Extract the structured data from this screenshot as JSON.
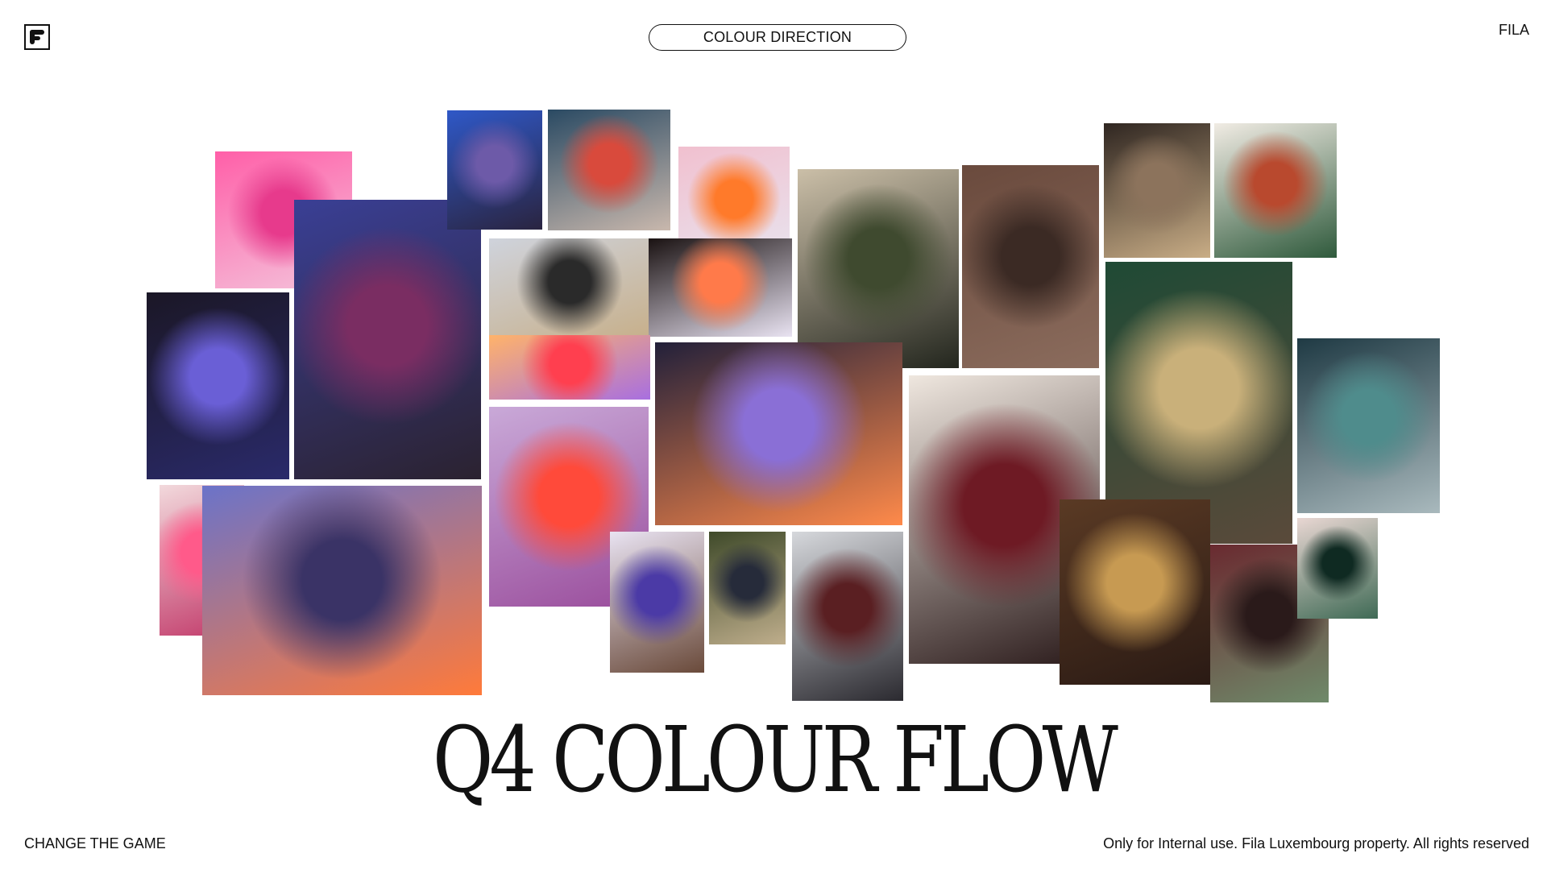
{
  "header": {
    "logo_icon": "fila-f-icon",
    "section_label": "COLOUR DIRECTION",
    "brand": "FILA"
  },
  "title": "Q4 COLOUR FLOW",
  "footer": {
    "tagline": "CHANGE THE GAME",
    "notice": "Only for Internal use. Fila Luxembourg property. All rights reserved"
  },
  "moodboard": {
    "images": [
      {
        "name": "pink-fabric-photo",
        "palette": [
          "#ff5fa8",
          "#e73a8c",
          "#f4c3db"
        ]
      },
      {
        "name": "purple-hooded-runway-photo",
        "palette": [
          "#3a3f95",
          "#7a2d62",
          "#2b2230"
        ]
      },
      {
        "name": "blue-buckle-fur-photo",
        "palette": [
          "#2f58c7",
          "#6d5aa8",
          "#2a2440"
        ]
      },
      {
        "name": "red-glow-dress-photo",
        "palette": [
          "#2a4a63",
          "#d94a3c",
          "#c9b8ad"
        ]
      },
      {
        "name": "orange-boot-ball-photo",
        "palette": [
          "#f1c0cf",
          "#ff7a2a",
          "#e8e4ef"
        ]
      },
      {
        "name": "studio-person-photo",
        "palette": [
          "#cfd3dc",
          "#2a2a2a",
          "#c7b08c"
        ]
      },
      {
        "name": "neon-x-photo",
        "palette": [
          "#1a1212",
          "#ff7a4a",
          "#e9e3f2"
        ]
      },
      {
        "name": "heat-gradient-photo",
        "palette": [
          "#ffb36a",
          "#ff3f4f",
          "#a86fe0"
        ]
      },
      {
        "name": "green-hood-photo",
        "palette": [
          "#cbbfa8",
          "#3f4a2f",
          "#23261e"
        ]
      },
      {
        "name": "brown-collar-photo",
        "palette": [
          "#6a4a3d",
          "#3b2a24",
          "#8b6c5d"
        ]
      },
      {
        "name": "mirror-room-photo",
        "palette": [
          "#2f2621",
          "#8c735c",
          "#c9ad86"
        ]
      },
      {
        "name": "fila-logo-tile-photo",
        "palette": [
          "#f1ece4",
          "#b9492e",
          "#2f5a3c"
        ]
      },
      {
        "name": "purple-puffer-photo",
        "palette": [
          "#1b1726",
          "#6a5fd6",
          "#2a2a6a"
        ]
      },
      {
        "name": "violet-eye-makeup-photo",
        "palette": [
          "#c9a9d8",
          "#ff4a3a",
          "#9a4d9c"
        ]
      },
      {
        "name": "glass-sphere-photo",
        "palette": [
          "#22203a",
          "#8a6fd6",
          "#ff8a4a"
        ]
      },
      {
        "name": "burgundy-polo-photo",
        "palette": [
          "#efe7df",
          "#6e1a24",
          "#2a1a1a"
        ]
      },
      {
        "name": "green-polo-portrait-photo",
        "palette": [
          "#1f4a35",
          "#c9b07a",
          "#5a4a3a"
        ]
      },
      {
        "name": "teal-bag-photo",
        "palette": [
          "#1f3a44",
          "#4f8c8c",
          "#a9b9bd"
        ]
      },
      {
        "name": "pink-sneaker-photo",
        "palette": [
          "#f2d9dc",
          "#ff5a8a",
          "#c23a6a"
        ]
      },
      {
        "name": "pyramids-dusk-photo",
        "palette": [
          "#6b73c9",
          "#3a3366",
          "#ff7a3a"
        ]
      },
      {
        "name": "bucket-hat-photo",
        "palette": [
          "#e9e3f2",
          "#4b3aa6",
          "#6a4a3a"
        ]
      },
      {
        "name": "navy-tracksuit-photo",
        "palette": [
          "#3f4a2a",
          "#262b3a",
          "#bfae8c"
        ]
      },
      {
        "name": "burgundy-jacket-photo",
        "palette": [
          "#d6d8dc",
          "#5a1f22",
          "#2b2a30"
        ]
      },
      {
        "name": "dap-brown-knit-photo",
        "palette": [
          "#5a3a24",
          "#c79a52",
          "#2a1a14"
        ]
      },
      {
        "name": "burgundy-leggings-photo",
        "palette": [
          "#6a2a30",
          "#2a1a1a",
          "#6f8a6a"
        ]
      },
      {
        "name": "green-lips-photo",
        "palette": [
          "#e9d7d3",
          "#0f2a22",
          "#3f6a55"
        ]
      }
    ]
  }
}
